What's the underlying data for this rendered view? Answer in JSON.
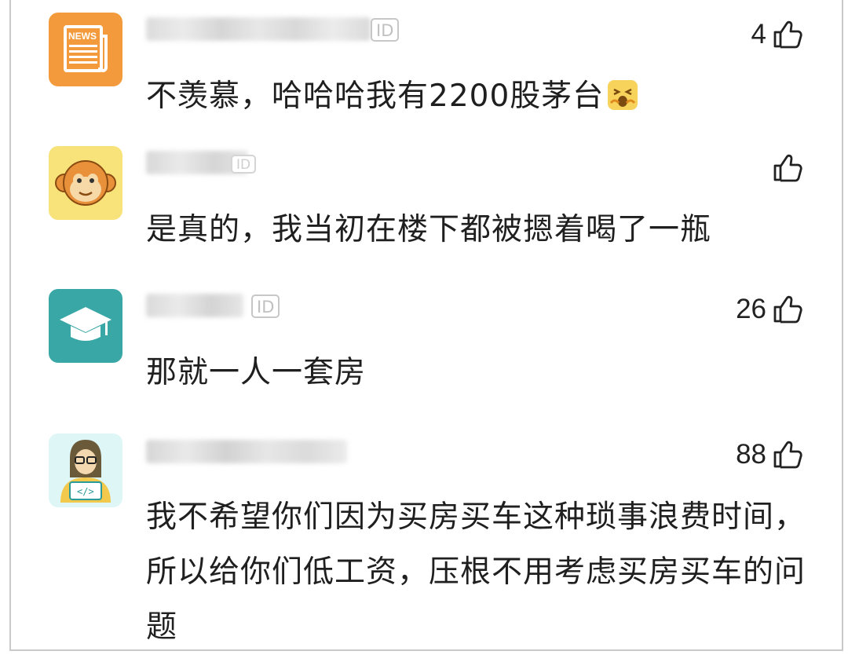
{
  "comments": [
    {
      "id_tag": "ID",
      "likes": "4",
      "text": "不羡慕，哈哈哈我有2200股茅台",
      "avatar_label": "NEWS",
      "colors": {
        "avatar_bg": "#f39b3c"
      }
    },
    {
      "id_tag": "ID",
      "likes": "",
      "text": "是真的，我当初在楼下都被摁着喝了一瓶",
      "colors": {
        "avatar_bg": "#f8e27a"
      }
    },
    {
      "id_tag": "ID",
      "likes": "26",
      "text": "那就一人一套房",
      "colors": {
        "avatar_bg": "#3aa7a7"
      }
    },
    {
      "id_tag": "",
      "likes": "88",
      "text": "我不希望你们因为买房买车这种琐事浪费时间，所以给你们低工资，压根不用考虑买房买车的问题",
      "avatar_label": "</>",
      "colors": {
        "avatar_bg": "#dff6f7"
      }
    }
  ],
  "icons": {
    "like": "thumbs-up-icon",
    "emoji": "emoji-icon"
  }
}
